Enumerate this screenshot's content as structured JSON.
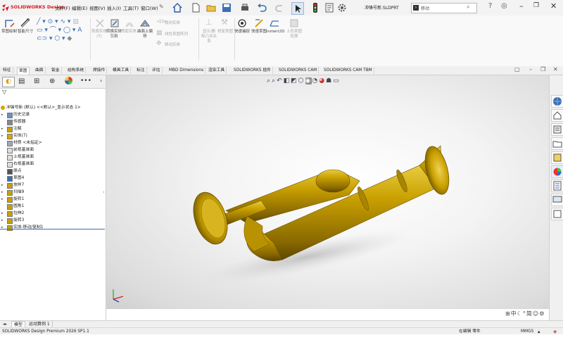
{
  "brand": {
    "logo_text": "SOLIDWORKS Design",
    "accent": "#d71920"
  },
  "menu": [
    "文件(F)",
    "编辑(E)",
    "视图(V)",
    "插入(I)",
    "工具(T)",
    "窗口(W)"
  ],
  "window": {
    "document_title": "冲锋号新.SLDPRT",
    "search_placeholder": "移动"
  },
  "ribbon": {
    "buttons": [
      {
        "label": "草图绘制",
        "enabled": true
      },
      {
        "label": "智能尺寸",
        "enabled": true
      },
      {
        "label": "剪裁实体(T)",
        "enabled": false
      },
      {
        "label": "转换实体引用",
        "enabled": true
      },
      {
        "label": "等距实体",
        "enabled": false
      },
      {
        "label": "曲面上偏移",
        "enabled": true
      },
      {
        "label": "镜向实体",
        "enabled": false
      },
      {
        "label": "线性草图阵列",
        "enabled": false
      },
      {
        "label": "移动实体",
        "enabled": false
      },
      {
        "label": "显示/删除几何关系",
        "enabled": false
      },
      {
        "label": "修复草图",
        "enabled": false
      },
      {
        "label": "快速捕捉",
        "enabled": true
      },
      {
        "label": "快速草图",
        "enabled": true
      },
      {
        "label": "Instant2D",
        "enabled": true
      },
      {
        "label": "上色草图轮廓",
        "enabled": false
      }
    ]
  },
  "command_tabs": [
    {
      "label": "特征",
      "active": false
    },
    {
      "label": "草图",
      "active": true
    },
    {
      "label": "曲面",
      "active": false
    },
    {
      "label": "钣金",
      "active": false
    },
    {
      "label": "结构系统",
      "active": false
    },
    {
      "label": "焊接件",
      "active": false
    },
    {
      "label": "模具工具",
      "active": false
    },
    {
      "label": "标注",
      "active": false
    },
    {
      "label": "评估",
      "active": false
    },
    {
      "label": "MBD Dimensions",
      "active": false
    },
    {
      "label": "渲染工具",
      "active": false
    },
    {
      "label": "SOLIDWORKS 插件",
      "active": false
    },
    {
      "label": "SOLIDWORKS CAM",
      "active": false
    },
    {
      "label": "SOLIDWORKS CAM TBM",
      "active": false
    }
  ],
  "feature_tree": {
    "filter_symbol": "▽",
    "root": "冲锋号新 (默认) <<默认>_显示状态 1>",
    "items": [
      {
        "label": "历史记录",
        "caret": "▸"
      },
      {
        "label": "传感器",
        "caret": ""
      },
      {
        "label": "注解",
        "caret": "▸"
      },
      {
        "label": "实体(7)",
        "caret": "▸"
      },
      {
        "label": "材质 <未指定>",
        "caret": ""
      },
      {
        "label": "前视基准面",
        "caret": ""
      },
      {
        "label": "上视基准面",
        "caret": ""
      },
      {
        "label": "右视基准面",
        "caret": ""
      },
      {
        "label": "原点",
        "caret": ""
      },
      {
        "label": "草图4",
        "caret": ""
      },
      {
        "label": "放样7",
        "caret": "▸"
      },
      {
        "label": "扫描9",
        "caret": "▸"
      },
      {
        "label": "旋转1",
        "caret": "▸"
      },
      {
        "label": "圆角1",
        "caret": ""
      },
      {
        "label": "拉伸2",
        "caret": "▸"
      },
      {
        "label": "旋转3",
        "caret": "▸"
      },
      {
        "label": "实体-移动/复制1",
        "caret": "▸"
      }
    ]
  },
  "bottom_tabs": [
    {
      "label": "模型",
      "active": true
    },
    {
      "label": "运动算例 1",
      "active": false
    }
  ],
  "status": {
    "product": "SOLIDWORKS Design Premium 2026 SP1.1",
    "mode": "在编辑 零件",
    "units": "MMGS"
  },
  "colors": {
    "part_gold": "#c9a000",
    "part_dark": "#7a5e00",
    "viewport_bg": "#e9e9e9"
  }
}
